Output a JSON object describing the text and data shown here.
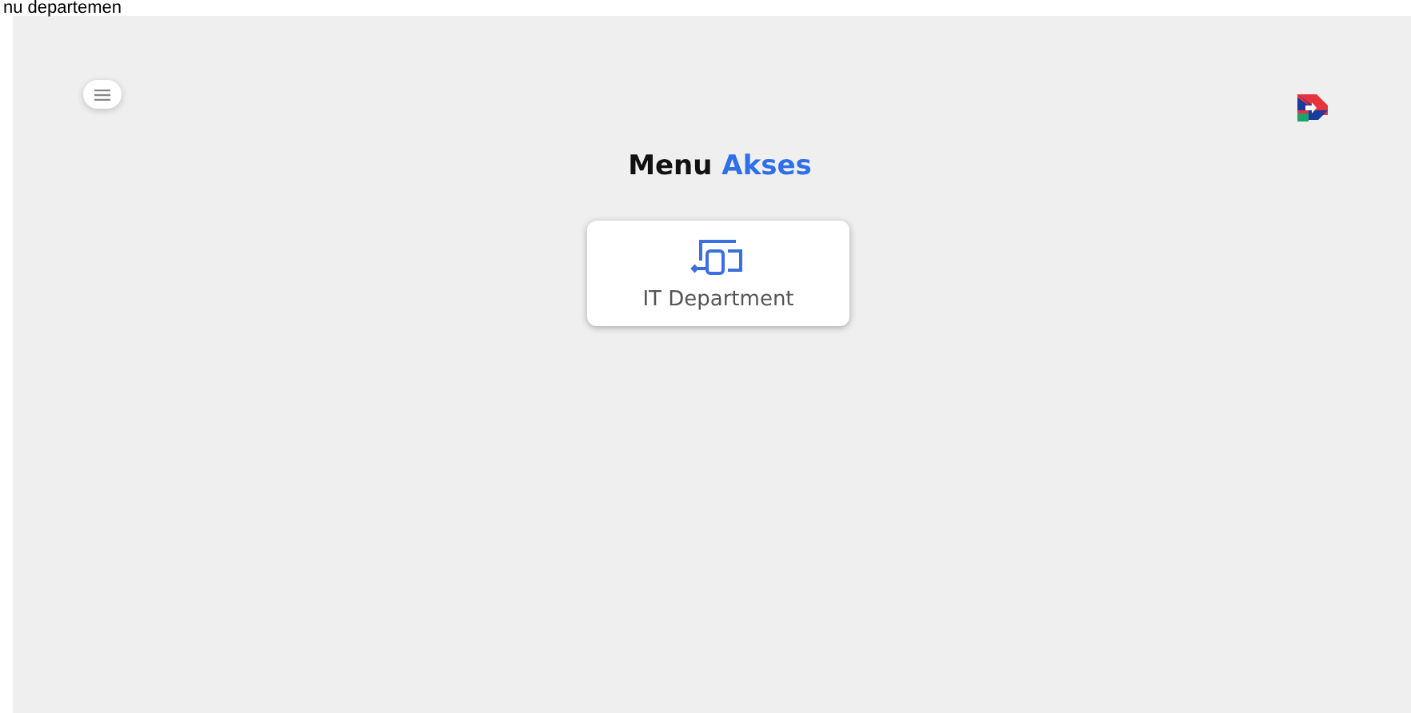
{
  "caption": "nu departemen",
  "heading": {
    "text": "Menu",
    "accent": "Akses"
  },
  "cards": [
    {
      "label": "IT Department",
      "kind": "devices"
    }
  ]
}
